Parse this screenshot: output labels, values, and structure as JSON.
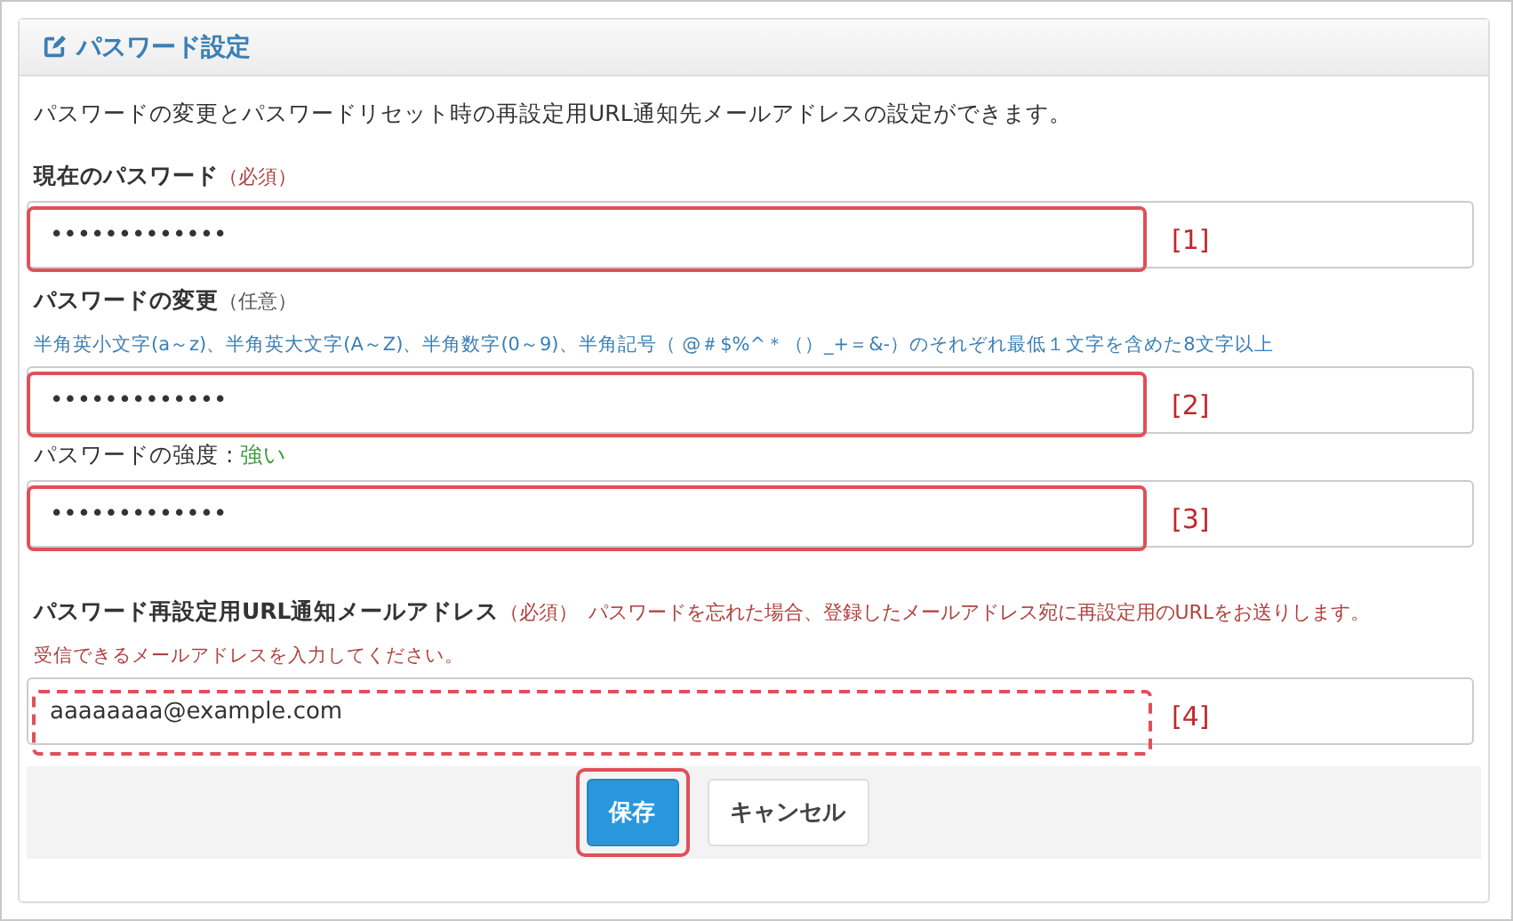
{
  "panel": {
    "title": "パスワード設定",
    "description": "パスワードの変更とパスワードリセット時の再設定用URL通知先メールアドレスの設定ができます。",
    "sections": [
      {
        "label": "現在のパスワード",
        "requirement": "（必須）",
        "required": true,
        "fields": [
          {
            "value": "•••••••••••••",
            "highlighted": true,
            "dashed": false,
            "marker": "[1]"
          }
        ]
      },
      {
        "label": "パスワードの変更",
        "requirement": "（任意）",
        "required": false,
        "hint": "半角英小文字(a～z)、半角英大文字(A～Z)、半角数字(0～9)、半角記号（ @＃$%^＊（）_+＝&-）のそれぞれ最低１文字を含めた8文字以上",
        "fields": [
          {
            "value": "•••••••••••••",
            "highlighted": true,
            "dashed": false,
            "marker": "[2]"
          }
        ],
        "strength": {
          "label": "パスワードの強度 : ",
          "value": "強い"
        },
        "confirm": [
          {
            "value": "•••••••••••••",
            "highlighted": true,
            "dashed": false,
            "marker": "[3]"
          }
        ]
      },
      {
        "label": "パスワード再設定用URL通知メールアドレス",
        "requirement": "（必須）",
        "required": true,
        "note": "パスワードを忘れた場合、登録したメールアドレス宛に再設定用のURLをお送りします。",
        "hint": "受信できるメールアドレスを入力してください。",
        "fields": [
          {
            "value": "aaaaaaaa@example.com",
            "highlighted": true,
            "dashed": true,
            "marker": "[4]"
          }
        ]
      }
    ],
    "buttons": [
      {
        "label": "保存",
        "kind": "primary",
        "highlighted": true
      },
      {
        "label": "キャンセル",
        "kind": "default",
        "highlighted": false
      }
    ]
  }
}
